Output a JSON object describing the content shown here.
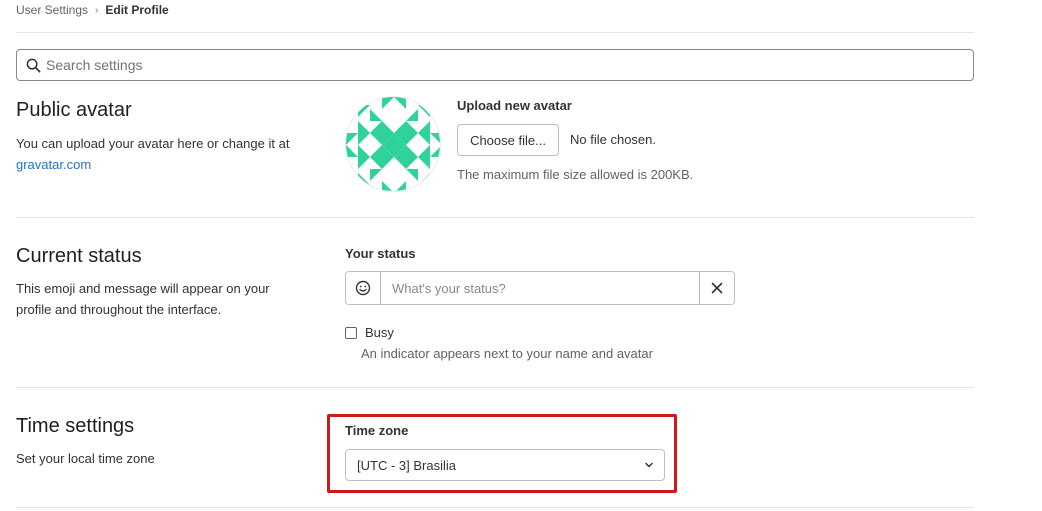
{
  "breadcrumb": {
    "parent": "User Settings",
    "current": "Edit Profile"
  },
  "search": {
    "placeholder": "Search settings",
    "icon": "search-icon"
  },
  "avatar_section": {
    "title": "Public avatar",
    "description": "You can upload your avatar here or change it at",
    "link": "gravatar.com",
    "upload_label": "Upload new avatar",
    "choose_button": "Choose file...",
    "file_status": "No file chosen.",
    "help": "The maximum file size allowed is 200KB.",
    "avatar_color": "#2fd39a"
  },
  "status_section": {
    "title": "Current status",
    "description": "This emoji and message will appear on your profile and throughout the interface.",
    "field_label": "Your status",
    "placeholder": "What's your status?",
    "emoji_icon": "smiley-icon",
    "clear_icon": "close-icon",
    "busy_label": "Busy",
    "busy_help": "An indicator appears next to your name and avatar"
  },
  "time_section": {
    "title": "Time settings",
    "description": "Set your local time zone",
    "field_label": "Time zone",
    "selected": "[UTC - 3] Brasilia",
    "chevron_icon": "chevron-down-icon",
    "highlight_color": "#cc1a1a"
  }
}
